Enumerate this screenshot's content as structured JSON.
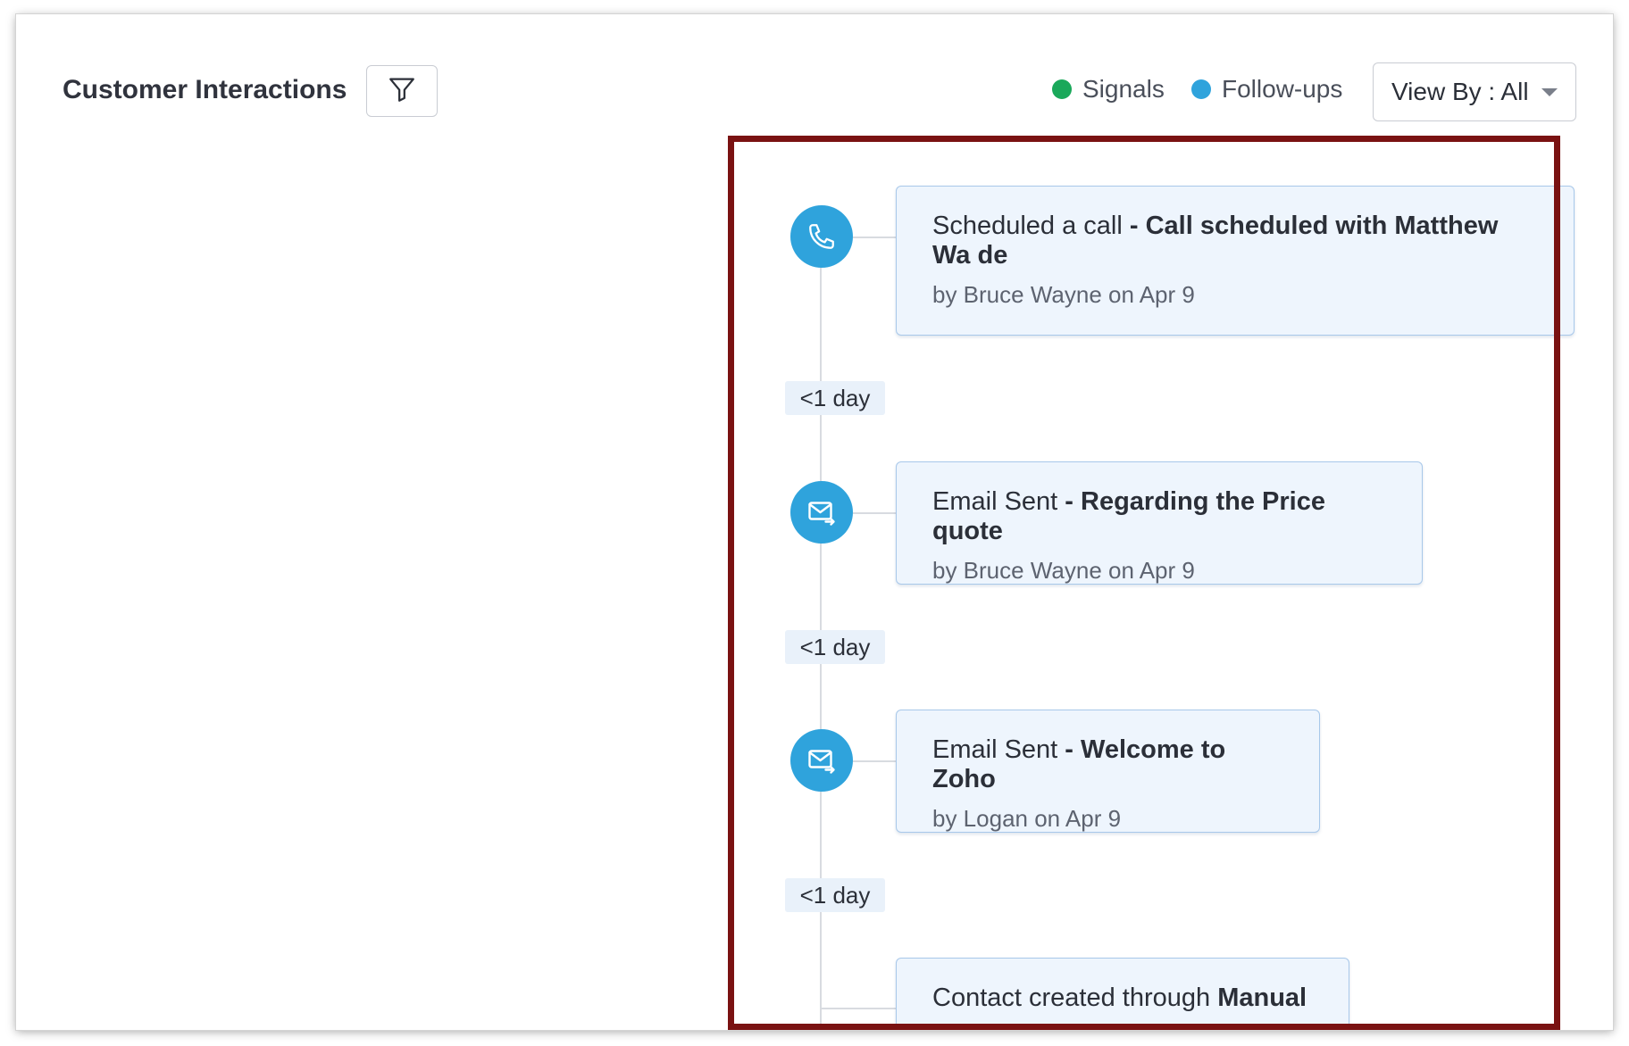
{
  "header": {
    "title": "Customer Interactions",
    "filter_icon": "funnel-icon",
    "legend": [
      {
        "label": "Signals",
        "color": "#1aa85a"
      },
      {
        "label": "Follow-ups",
        "color": "#2fa3dc"
      }
    ],
    "view_by_label": "View By : All"
  },
  "timeline": [
    {
      "icon": "phone-icon",
      "type": "Scheduled a call",
      "separator": " - ",
      "subject": "Call scheduled with Matthew Wa de",
      "meta": "by Bruce Wayne on Apr 9"
    },
    {
      "icon": "email-sent-icon",
      "type": "Email Sent",
      "separator": " - ",
      "subject": "Regarding the Price quote",
      "meta": "by Bruce Wayne on Apr 9"
    },
    {
      "icon": "email-sent-icon",
      "type": "Email Sent",
      "separator": " - ",
      "subject": "Welcome to Zoho",
      "meta": "by Logan on Apr 9"
    },
    {
      "type": "Contact created through",
      "separator": " ",
      "subject": "Manual"
    }
  ],
  "gaps": [
    "<1 day",
    "<1 day",
    "<1 day"
  ]
}
